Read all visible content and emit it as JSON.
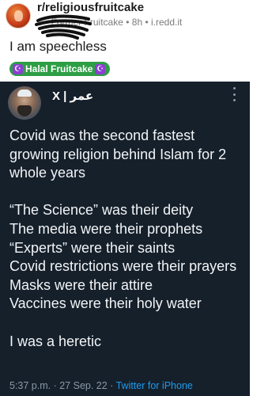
{
  "reddit": {
    "subreddit": "r/religiousfruitcake",
    "meta_prefix": ".. • ",
    "author_flair_text": "Former Fruitcake",
    "separator": " • ",
    "age": "8h",
    "domain": "i.redd.it",
    "post_title": "I am speechless",
    "flair": "Halal Fruitcake",
    "flair_color": "#2e9e45"
  },
  "tweet": {
    "display_name": "X | عمر",
    "lines": [
      "Covid was the second fastest growing religion behind Islam for 2 whole years",
      "",
      "“The Science” was their deity",
      "The media were their prophets",
      "“Experts” were their saints",
      "Covid restrictions were their prayers",
      "Masks were their attire",
      "Vaccines were their holy water",
      "",
      "I was a heretic"
    ],
    "time": "5:37 p.m.",
    "date": "27 Sep. 22",
    "client": "Twitter for iPhone",
    "footer_sep": " · ",
    "background": "#15202b",
    "link_color": "#1d9bf0"
  }
}
